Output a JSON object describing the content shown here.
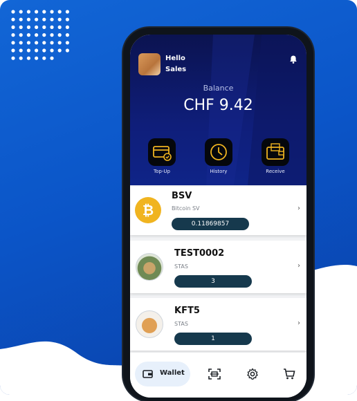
{
  "header": {
    "greeting_line1": "Hello",
    "greeting_line2": "Sales",
    "balance_label": "Balance",
    "balance_value": "CHF 9.42"
  },
  "actions": [
    {
      "label": "Top-Up",
      "icon": "topup-card-icon"
    },
    {
      "label": "History",
      "icon": "clock-icon"
    },
    {
      "label": "Receive",
      "icon": "wallet-receive-icon"
    }
  ],
  "tokens": [
    {
      "name": "BSV",
      "sub": "Bitcoin SV",
      "amount": "0.11869857",
      "icon": "bitcoin-icon"
    },
    {
      "name": "TEST0002",
      "sub": "STAS",
      "amount": "3",
      "icon": "tea-cup-token-icon"
    },
    {
      "name": "KFT5",
      "sub": "STAS",
      "amount": "1",
      "icon": "dog-token-icon"
    }
  ],
  "nav": {
    "wallet_label": "Wallet"
  },
  "colors": {
    "background": "#0b55c8",
    "header": "#0f1e7a",
    "pill": "#16394d",
    "bitcoin": "#f0b420"
  }
}
